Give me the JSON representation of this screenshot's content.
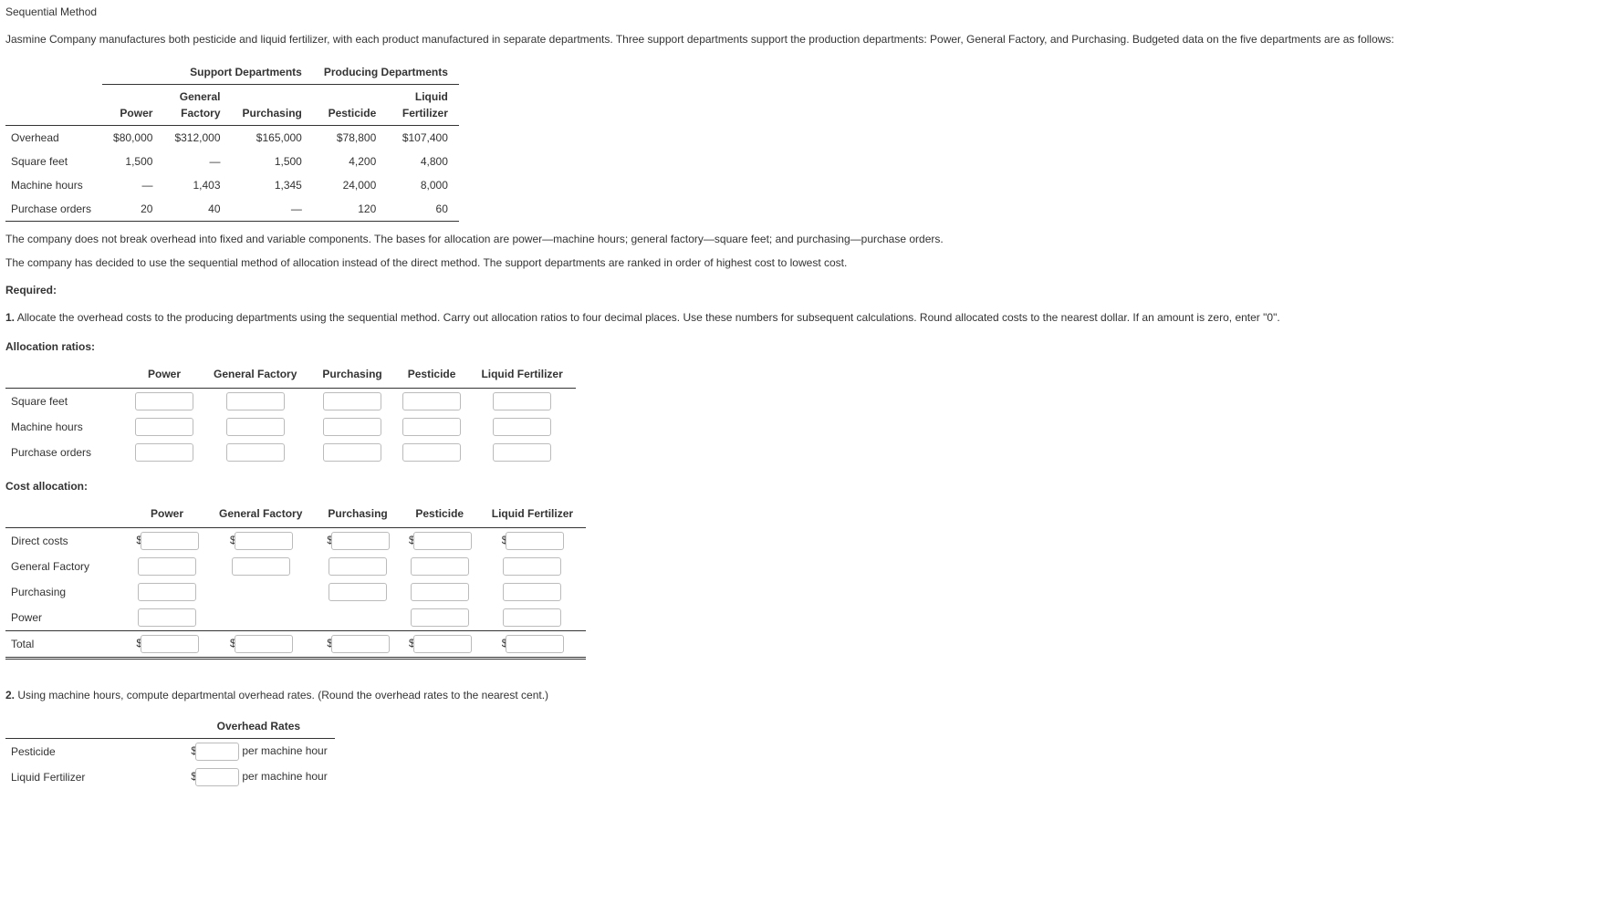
{
  "title": "Sequential Method",
  "intro": "Jasmine Company manufactures both pesticide and liquid fertilizer, with each product manufactured in separate departments. Three support departments support the production departments: Power, General Factory, and Purchasing. Budgeted data on the five departments are as follows:",
  "group_headers": {
    "support": "Support Departments",
    "producing": "Producing Departments"
  },
  "columns": {
    "c1": "Power",
    "c2_line1": "General",
    "c2_line2": "Factory",
    "c3": "Purchasing",
    "c4": "Pesticide",
    "c5_line1": "Liquid",
    "c5_line2": "Fertilizer"
  },
  "rows": {
    "overhead": {
      "label": "Overhead",
      "c1": "$80,000",
      "c2": "$312,000",
      "c3": "$165,000",
      "c4": "$78,800",
      "c5": "$107,400"
    },
    "sqft": {
      "label": "Square feet",
      "c1": "1,500",
      "c2": "—",
      "c3": "1,500",
      "c4": "4,200",
      "c5": "4,800"
    },
    "mh": {
      "label": "Machine hours",
      "c1": "—",
      "c2": "1,403",
      "c3": "1,345",
      "c4": "24,000",
      "c5": "8,000"
    },
    "po": {
      "label": "Purchase orders",
      "c1": "20",
      "c2": "40",
      "c3": "—",
      "c4": "120",
      "c5": "60"
    }
  },
  "note1": "The company does not break overhead into fixed and variable components. The bases for allocation are power—machine hours; general factory—square feet; and purchasing—purchase orders.",
  "note2": "The company has decided to use the sequential method of allocation instead of the direct method. The support departments are ranked in order of highest cost to lowest cost.",
  "required_label": "Required:",
  "req1_prefix": "1.",
  "req1": "Allocate the overhead costs to the producing departments using the sequential method. Carry out allocation ratios to four decimal places. Use these numbers for subsequent calculations. Round allocated costs to the nearest dollar. If an amount is zero, enter \"0\".",
  "alloc_title": "Allocation ratios:",
  "alloc_cols": {
    "c1": "Power",
    "c2": "General Factory",
    "c3": "Purchasing",
    "c4": "Pesticide",
    "c5": "Liquid Fertilizer"
  },
  "alloc_rows": {
    "r1": "Square feet",
    "r2": "Machine hours",
    "r3": "Purchase orders"
  },
  "cost_title": "Cost allocation:",
  "cost_rows": {
    "r1": "Direct costs",
    "r2": "General Factory",
    "r3": "Purchasing",
    "r4": "Power",
    "r5": "Total"
  },
  "req2_prefix": "2.",
  "req2": "Using machine hours, compute departmental overhead rates. (Round the overhead rates to the nearest cent.)",
  "rates_header": "Overhead Rates",
  "rates_rows": {
    "r1": "Pesticide",
    "r2": "Liquid Fertilizer"
  },
  "per_mh": "per machine hour",
  "dollar": "$"
}
